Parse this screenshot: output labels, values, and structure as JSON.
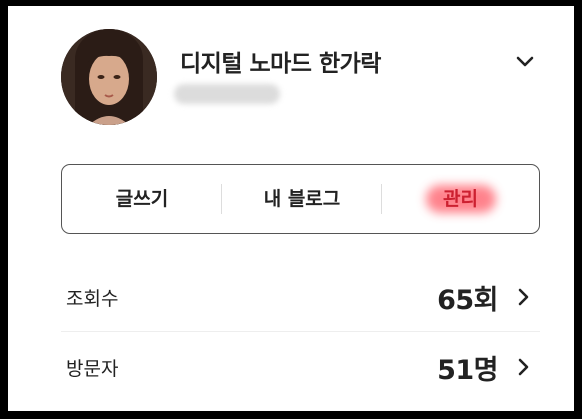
{
  "profile": {
    "name": "디지털 노마드 한가락",
    "avatar_icon": "avatar-portrait",
    "toggle_icon": "chevron-down-icon"
  },
  "actions": {
    "write": "글쓰기",
    "my_blog": "내 블로그",
    "manage": "관리",
    "highlight_color": "#ff6d78"
  },
  "stats": {
    "views_label": "조회수",
    "views_value": "65회",
    "visitors_label": "방문자",
    "visitors_value": "51명",
    "row_icon": "chevron-right-icon"
  }
}
